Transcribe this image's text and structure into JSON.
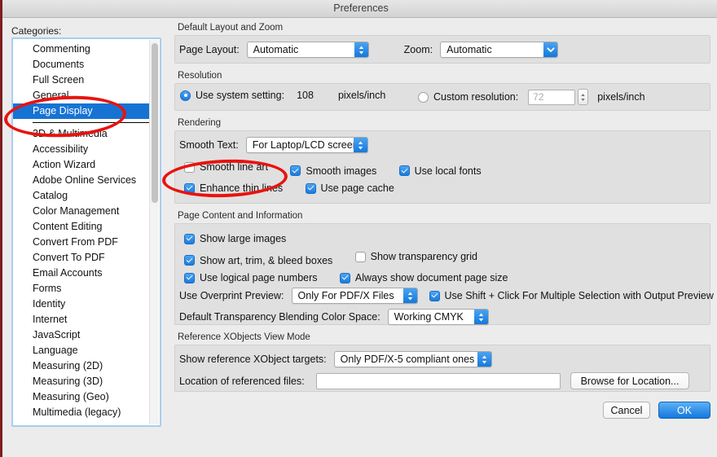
{
  "window": {
    "title": "Preferences"
  },
  "sidebar": {
    "label": "Categories:",
    "items_top": [
      {
        "label": "Commenting"
      },
      {
        "label": "Documents"
      },
      {
        "label": "Full Screen"
      },
      {
        "label": "General"
      },
      {
        "label": "Page Display",
        "selected": true
      }
    ],
    "items_bottom": [
      {
        "label": "3D & Multimedia"
      },
      {
        "label": "Accessibility"
      },
      {
        "label": "Action Wizard"
      },
      {
        "label": "Adobe Online Services"
      },
      {
        "label": "Catalog"
      },
      {
        "label": "Color Management"
      },
      {
        "label": "Content Editing"
      },
      {
        "label": "Convert From PDF"
      },
      {
        "label": "Convert To PDF"
      },
      {
        "label": "Email Accounts"
      },
      {
        "label": "Forms"
      },
      {
        "label": "Identity"
      },
      {
        "label": "Internet"
      },
      {
        "label": "JavaScript"
      },
      {
        "label": "Language"
      },
      {
        "label": "Measuring (2D)"
      },
      {
        "label": "Measuring (3D)"
      },
      {
        "label": "Measuring (Geo)"
      },
      {
        "label": "Multimedia (legacy)"
      }
    ]
  },
  "layout_zoom": {
    "group_title": "Default Layout and Zoom",
    "page_layout_label": "Page Layout:",
    "page_layout_value": "Automatic",
    "zoom_label": "Zoom:",
    "zoom_value": "Automatic"
  },
  "resolution": {
    "group_title": "Resolution",
    "system_label": "Use system setting:",
    "system_selected": true,
    "system_value": "108",
    "system_units": "pixels/inch",
    "custom_label": "Custom resolution:",
    "custom_selected": false,
    "custom_placeholder": "72",
    "custom_units": "pixels/inch"
  },
  "rendering": {
    "group_title": "Rendering",
    "smooth_text_label": "Smooth Text:",
    "smooth_text_value": "For Laptop/LCD screens",
    "checkboxes": [
      {
        "label": "Smooth line art",
        "checked": false
      },
      {
        "label": "Smooth images",
        "checked": true
      },
      {
        "label": "Use local fonts",
        "checked": true
      },
      {
        "label": "Enhance thin lines",
        "checked": true
      },
      {
        "label": "Use page cache",
        "checked": true
      }
    ]
  },
  "page_content": {
    "group_title": "Page Content and Information",
    "checkboxes": [
      {
        "label": "Show large images",
        "checked": true
      },
      {
        "label": "Show art, trim, & bleed boxes",
        "checked": true
      },
      {
        "label": "Show transparency grid",
        "checked": false
      },
      {
        "label": "Use logical page numbers",
        "checked": true
      },
      {
        "label": "Always show document page size",
        "checked": true
      }
    ],
    "overprint_label": "Use Overprint Preview:",
    "overprint_value": "Only For PDF/X Files",
    "shift_click_label": "Use Shift + Click For Multiple Selection with Output Preview",
    "shift_click_checked": true,
    "blending_label": "Default Transparency Blending Color Space:",
    "blending_value": "Working CMYK"
  },
  "reference_xobjects": {
    "group_title": "Reference XObjects View Mode",
    "targets_label": "Show reference XObject targets:",
    "targets_value": "Only PDF/X-5 compliant ones",
    "location_label": "Location of referenced files:",
    "location_value": "",
    "browse_label": "Browse for Location..."
  },
  "footer": {
    "cancel_label": "Cancel",
    "ok_label": "OK"
  },
  "annotations": {
    "ellipse_color": "#e8130f",
    "marks": [
      {
        "name": "page-display-highlight"
      },
      {
        "name": "smooth-line-art-highlight"
      }
    ]
  },
  "colors": {
    "accent": "#1673d4",
    "selection": "#1673d4",
    "annotation": "#e8130f",
    "group_bg": "#e0e0e0",
    "window_bg": "#ececec"
  }
}
